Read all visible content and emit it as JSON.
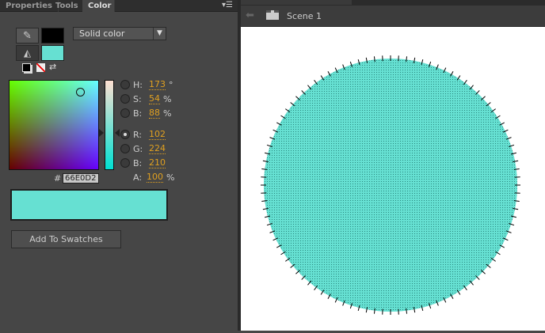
{
  "tabs": [
    "Properties",
    "Tools",
    "Color"
  ],
  "fill_type": "Solid color",
  "hsb": [
    {
      "label": "H:",
      "value": "173",
      "unit": "°"
    },
    {
      "label": "S:",
      "value": "54",
      "unit": "%"
    },
    {
      "label": "B:",
      "value": "88",
      "unit": "%"
    }
  ],
  "rgb": [
    {
      "label": "R:",
      "value": "102"
    },
    {
      "label": "G:",
      "value": "224"
    },
    {
      "label": "B:",
      "value": "210"
    }
  ],
  "alpha": {
    "label": "A:",
    "value": "100",
    "unit": "%"
  },
  "hex": {
    "prefix": "#",
    "value": "66E0D2"
  },
  "add_swatches": "Add To Swatches",
  "scene": "Scene 1",
  "colors": {
    "stroke": "#000000",
    "fill": "#66E0D2"
  }
}
